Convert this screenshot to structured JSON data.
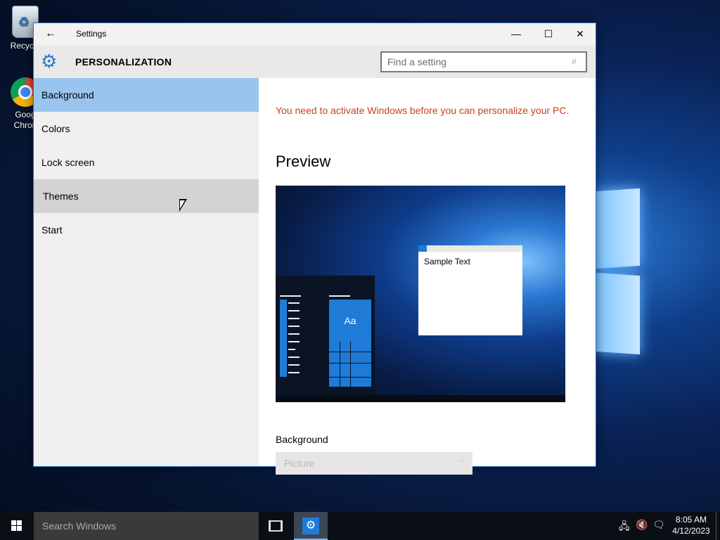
{
  "desktop": {
    "icons": [
      {
        "label": "Recycle",
        "icon": "recycle-bin-icon"
      },
      {
        "label": "Goog\nChron",
        "icon": "chrome-icon"
      }
    ]
  },
  "window": {
    "title": "Settings",
    "back_icon": "back-arrow-icon",
    "min_glyph": "—",
    "max_glyph": "☐",
    "close_glyph": "✕"
  },
  "header": {
    "icon": "gear-icon",
    "title": "PERSONALIZATION",
    "search_placeholder": "Find a setting"
  },
  "sidebar": {
    "items": [
      {
        "label": "Background",
        "state": "selected"
      },
      {
        "label": "Colors",
        "state": "normal"
      },
      {
        "label": "Lock screen",
        "state": "normal"
      },
      {
        "label": "Themes",
        "state": "hover"
      },
      {
        "label": "Start",
        "state": "normal"
      }
    ]
  },
  "content": {
    "warning": "You need to activate Windows before you can personalize your PC.",
    "preview_heading": "Preview",
    "preview": {
      "tile_text": "Aa",
      "sample_text": "Sample Text"
    },
    "background_label": "Background",
    "background_value": "Picture"
  },
  "taskbar": {
    "search_placeholder": "Search Windows",
    "time": "8:05 AM",
    "date": "4/12/2023"
  },
  "colors": {
    "accent": "#1f7bd6",
    "selected": "#99c4ee",
    "warning": "#c8401b"
  }
}
